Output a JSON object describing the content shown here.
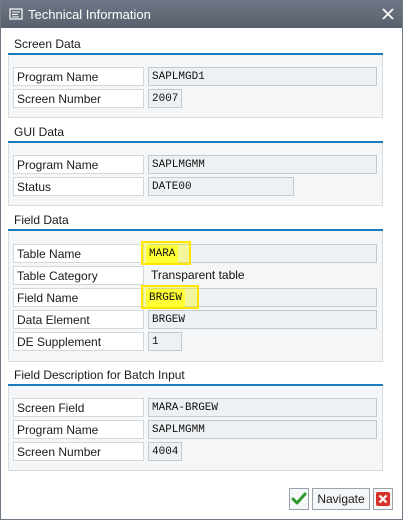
{
  "window": {
    "title": "Technical Information",
    "icons": {
      "title": "window-icon",
      "close": "close-icon"
    }
  },
  "screen_data": {
    "title": "Screen Data",
    "program_name_label": "Program Name",
    "program_name_value": "SAPLMGD1",
    "screen_number_label": "Screen Number",
    "screen_number_value": "2007"
  },
  "gui_data": {
    "title": "GUI Data",
    "program_name_label": "Program Name",
    "program_name_value": "SAPLMGMM",
    "status_label": "Status",
    "status_value": "DATE00"
  },
  "field_data": {
    "title": "Field Data",
    "table_name_label": "Table Name",
    "table_name_value": "MARA",
    "table_category_label": "Table Category",
    "table_category_value": "Transparent table",
    "field_name_label": "Field Name",
    "field_name_value": "BRGEW",
    "data_element_label": "Data Element",
    "data_element_value": "BRGEW",
    "de_supplement_label": "DE Supplement",
    "de_supplement_value": "1"
  },
  "batch_input": {
    "title": "Field Description for Batch Input",
    "screen_field_label": "Screen Field",
    "screen_field_value": "MARA-BRGEW",
    "program_name_label": "Program Name",
    "program_name_value": "SAPLMGMM",
    "screen_number_label": "Screen Number",
    "screen_number_value": "4004"
  },
  "buttons": {
    "navigate_label": "Navigate",
    "ok_icon": "checkmark-icon",
    "cancel_icon": "cancel-icon"
  },
  "colors": {
    "titlebar": "#5f6875",
    "group_line": "#1f7bbf",
    "highlight": "#ffff33",
    "ok_green": "#2e9a2e",
    "cancel_red": "#d6312b"
  }
}
